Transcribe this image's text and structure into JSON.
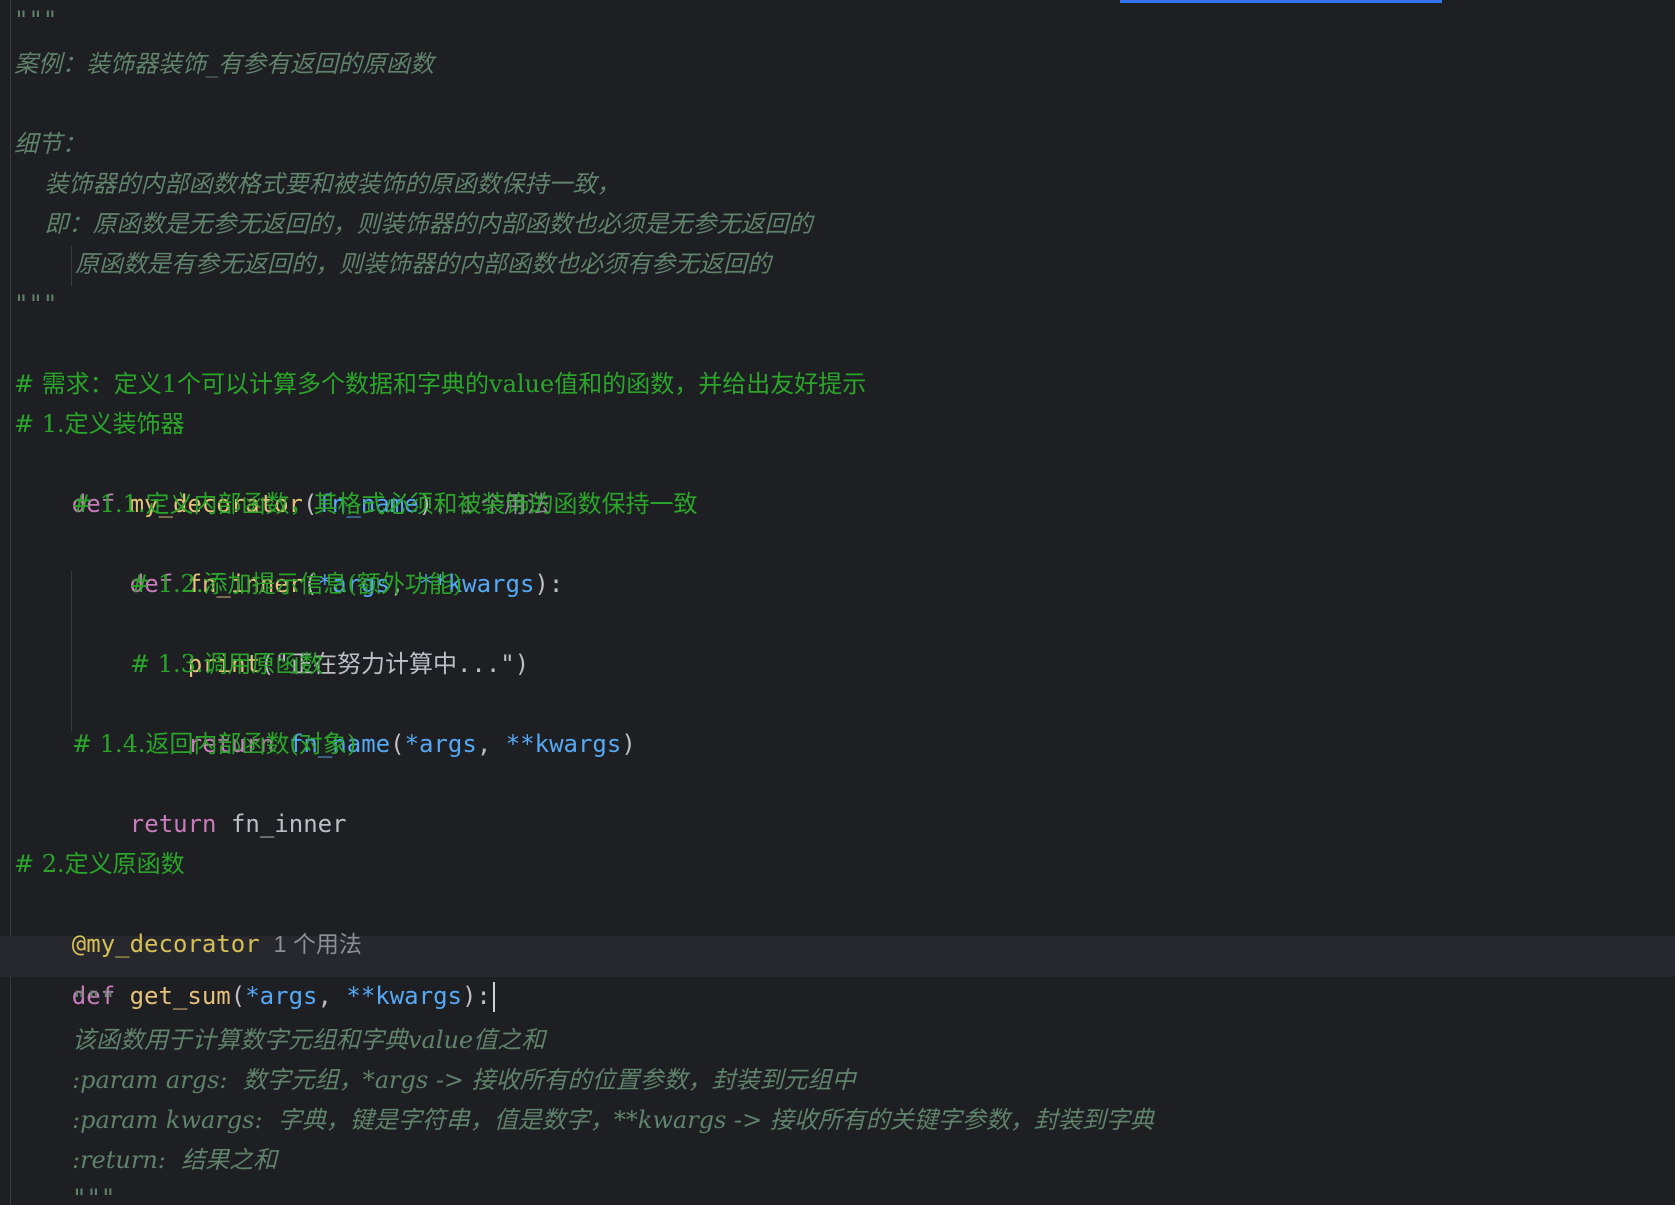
{
  "editor": {
    "lines": [
      {
        "id": "l1",
        "text": "\"\"\""
      },
      {
        "id": "l2",
        "text": "案例：装饰器装饰_有参有返回的原函数"
      },
      {
        "id": "l3",
        "text": ""
      },
      {
        "id": "l4",
        "text": "细节："
      },
      {
        "id": "l5",
        "text": "    装饰器的内部函数格式要和被装饰的原函数保持一致，"
      },
      {
        "id": "l6",
        "text": "    即：原函数是无参无返回的，则装饰器的内部函数也必须是无参无返回的"
      },
      {
        "id": "l7",
        "text": "        原函数是有参无返回的，则装饰器的内部函数也必须有参无返回的"
      },
      {
        "id": "l8",
        "text": "\"\"\""
      }
    ],
    "comment_requirement": "# 需求：定义1个可以计算多个数据和字典的value值和的函数，并给出友好提示",
    "comment_step1": "# 1.定义装饰器",
    "def_decorator": {
      "kw": "def",
      "name": "my_decorator",
      "open": "(",
      "param": "fn_name",
      "close": "):",
      "usage_hint": "1 个用法"
    },
    "comment_step11": "# 1.1.定义内部函数，其格式必须和被装饰的函数保持一致",
    "def_inner": {
      "kw": "def",
      "name": "fn_inner",
      "open": "(",
      "p1": "*args",
      "sep": ", ",
      "p2": "**kwargs",
      "close": "):"
    },
    "comment_step12": "# 1.2.添加提示信息(额外功能)",
    "print_line": {
      "fn": "print",
      "open": "(",
      "str": "\"正在努力计算中...\"",
      "close": ")"
    },
    "comment_step13": "# 1.3.调用原函数",
    "return_call": {
      "kw": "return",
      "fn": "fn_name",
      "open": "(",
      "p1": "*args",
      "sep": ", ",
      "p2": "**kwargs",
      "close": ")"
    },
    "comment_step14": "# 1.4.返回内部函数(对象)",
    "return_inner": {
      "kw": "return",
      "value": "fn_inner"
    },
    "comment_step2": "# 2.定义原函数",
    "decorator_line": {
      "text": "@my_decorator",
      "usage_hint": "1 个用法"
    },
    "def_get_sum": {
      "kw": "def",
      "name": "get_sum",
      "open": "(",
      "p1": "*args",
      "sep": ", ",
      "p2": "**kwargs",
      "close": "):"
    },
    "docstring": {
      "open": "\"\"\"",
      "desc": "该函数用于计算数字元组和字典value值之和",
      "param_args": ":param args:  数字元组，*args -> 接收所有的位置参数，封装到元组中",
      "param_kwargs": ":param kwargs:  字典，键是字符串，值是数字，**kwargs -> 接收所有的关键字参数，封装到字典",
      "return": ":return:  结果之和",
      "close": "\"\"\""
    }
  }
}
